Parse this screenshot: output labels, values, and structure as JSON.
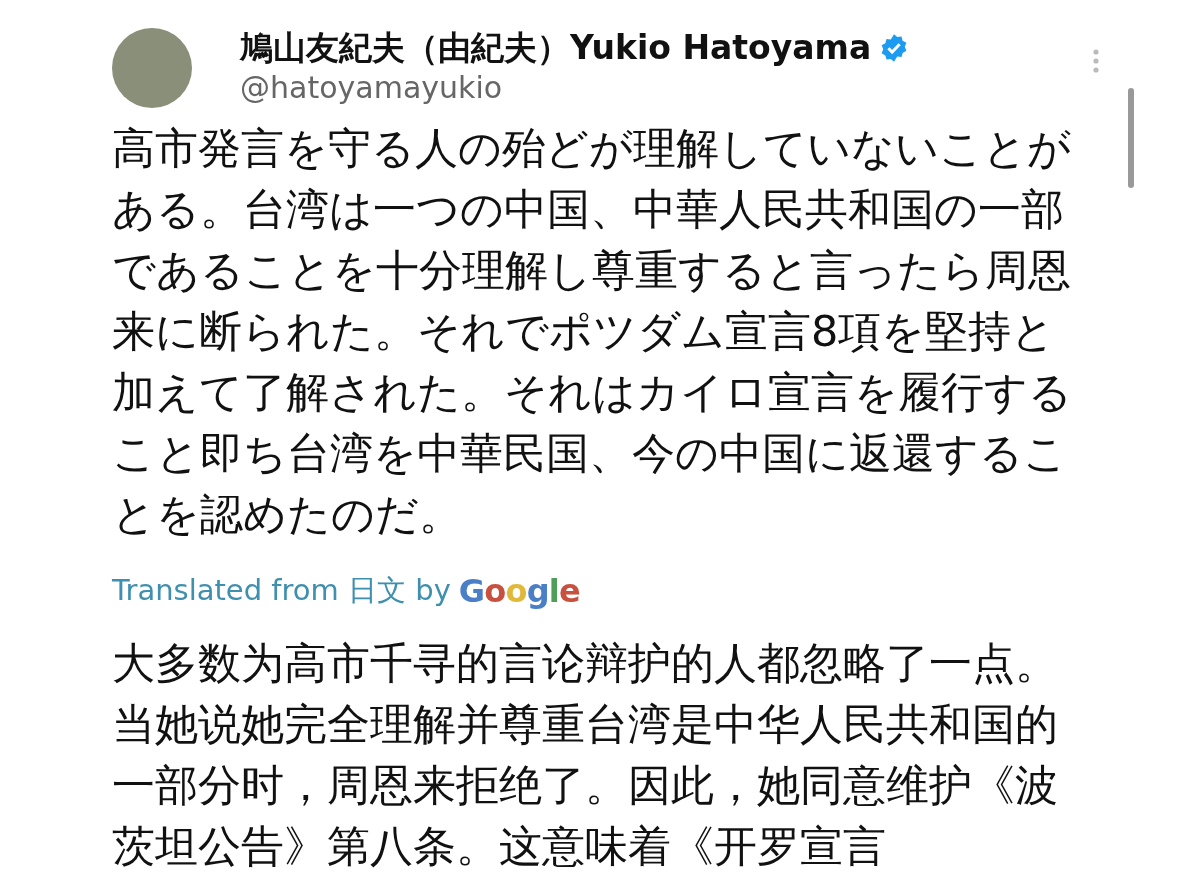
{
  "author": {
    "name": "鳩山友紀夫（由紀夫）Yukio Hatoyama",
    "verified": true,
    "handle": "@hatoyamayukio"
  },
  "post": {
    "text": "高市発言を守る人の殆どが理解していないことがある。台湾は一つの中国、中華人民共和国の一部であることを十分理解し尊重すると言ったら周恩来に断られた。それでポツダム宣言8項を堅持と加えて了解された。それはカイロ宣言を履行すること即ち台湾を中華民国、今の中国に返還することを認めたのだ。"
  },
  "translation": {
    "label": "Translated from 日文 by",
    "provider": "Google",
    "text": "大多数为高市千寻的言论辩护的人都忽略了一点。当她说她完全理解并尊重台湾是中华人民共和国的一部分时，周恩来拒绝了。因此，她同意维护《波茨坦公告》第八条。这意味着《开罗宣言"
  }
}
